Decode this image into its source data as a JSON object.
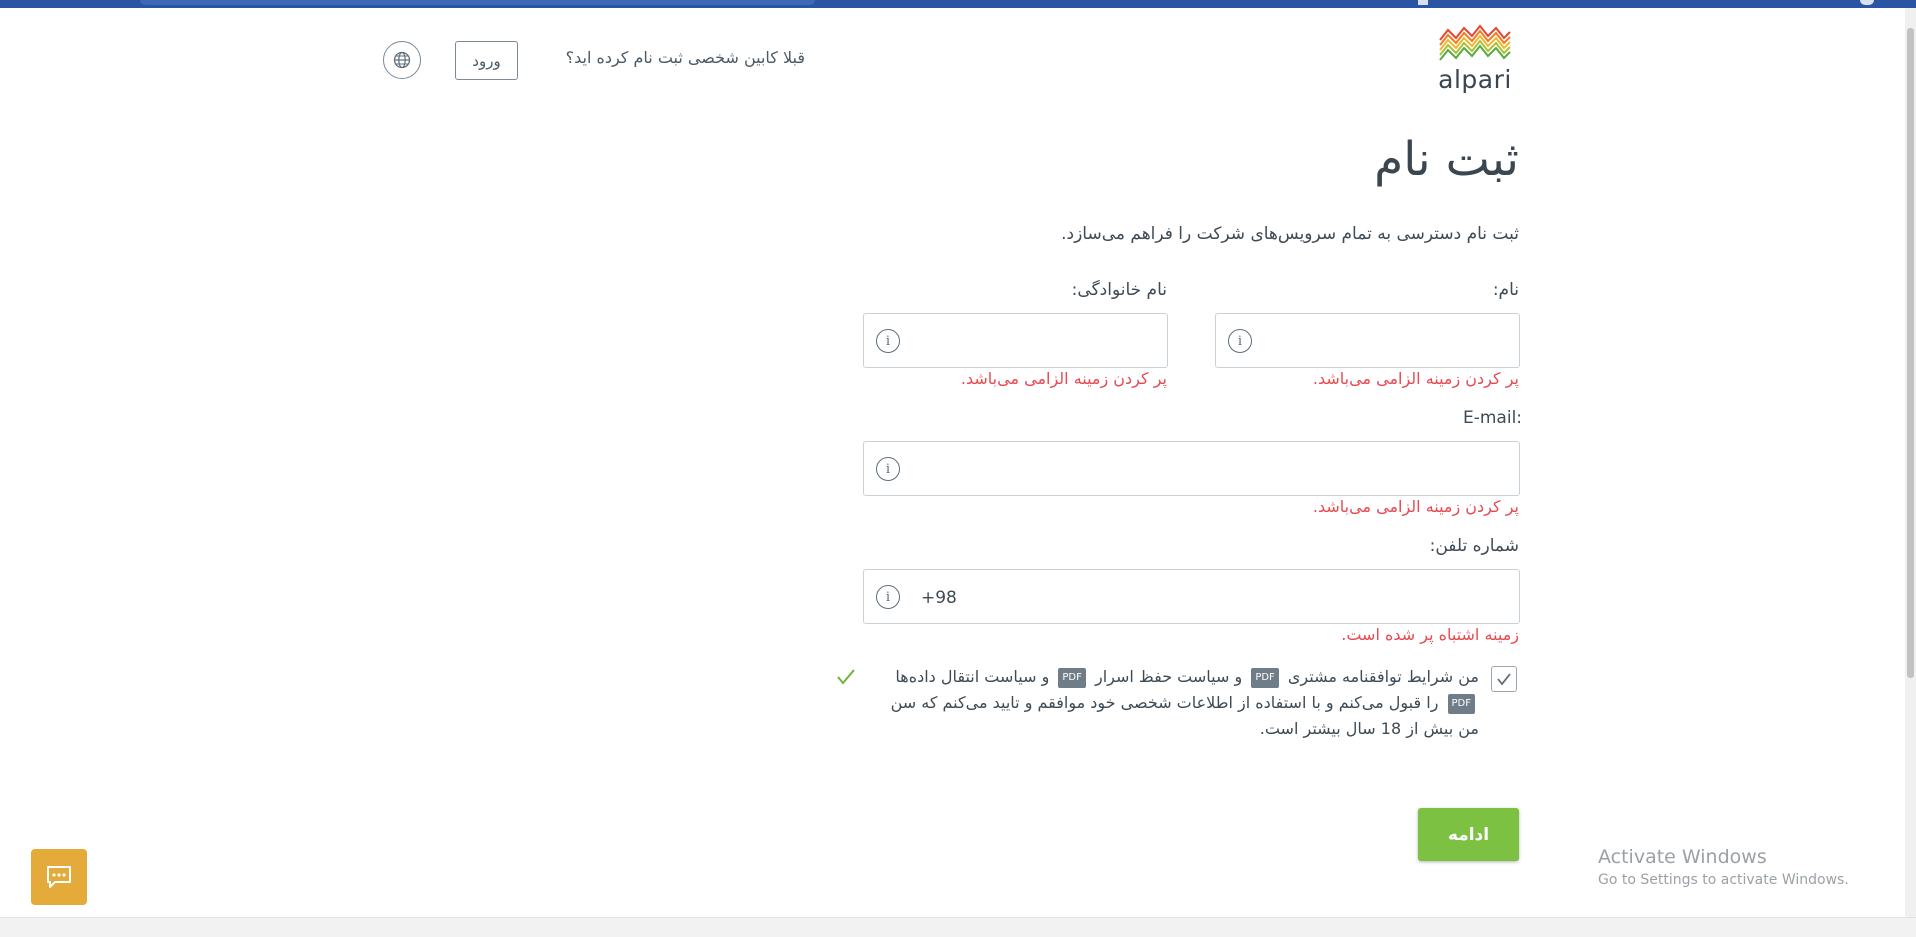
{
  "header": {
    "already_registered": "قبلا کابین شخصی ثبت نام کرده اید؟",
    "login_label": "ورود",
    "language_icon": "globe-icon",
    "logo_text": "alpari"
  },
  "page": {
    "title": "ثبت نام",
    "subtitle": "ثبت نام دسترسی به تمام سرویس‌های شرکت را فراهم می‌سازد."
  },
  "form": {
    "first_name": {
      "label": "نام:",
      "value": "",
      "error": "پر کردن زمینه الزامی می‌باشد."
    },
    "last_name": {
      "label": "نام خانوادگی:",
      "value": "",
      "error": "پر کردن زمینه الزامی می‌باشد."
    },
    "email": {
      "label": "E-mail:",
      "value": "",
      "error": "پر کردن زمینه الزامی می‌باشد."
    },
    "phone": {
      "label": "شماره تلفن:",
      "value": "+98",
      "error": "زمینه اشتباه پر شده است."
    },
    "info_icon_text": "i",
    "agreement": {
      "part1": "من شرایط توافقنامه مشتری",
      "pdf": "PDF",
      "part2": "و سیاست حفظ اسرار",
      "part3": "و سیاست انتقال داده‌ها",
      "part4": "را قبول می‌کنم و با استفاده از اطلاعات شخصی خود موافقم و تایید می‌کنم که سن من بیش از 18 سال بیشتر است.",
      "checked": true
    },
    "continue_label": "ادامه"
  },
  "chat": {
    "icon": "chat-icon"
  },
  "watermark": {
    "line1": "Activate Windows",
    "line2": "Go to Settings to activate Windows."
  },
  "colors": {
    "accent_green": "#7cc142",
    "error_red": "#e84a50",
    "chat_orange": "#e4aa3a",
    "text": "#3e4b56"
  }
}
